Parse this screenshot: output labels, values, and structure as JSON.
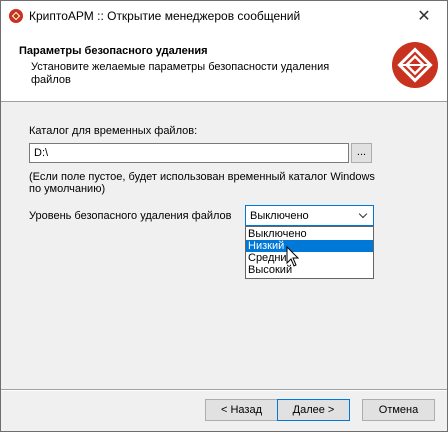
{
  "window": {
    "title": "КриптоАРМ :: Открытие менеджеров сообщений",
    "close_glyph": "✕"
  },
  "header": {
    "title": "Параметры безопасного удаления",
    "subtitle": "Установите желаемые параметры безопасности удаления файлов"
  },
  "temp_dir": {
    "label": "Каталог для временных файлов:",
    "value": "D:\\",
    "browse_label": "...",
    "note": "(Если поле пустое, будет использован временный каталог Windows по умолчанию)"
  },
  "deletion_level": {
    "label": "Уровень безопасного удаления файлов",
    "selected": "Выключено",
    "options": [
      "Выключено",
      "Низкий",
      "Средний",
      "Высокий"
    ],
    "highlighted": "Низкий"
  },
  "buttons": {
    "back": "< Назад",
    "next": "Далее >",
    "cancel": "Отмена"
  },
  "colors": {
    "accent": "#0078d7",
    "logo_red": "#c8321e"
  },
  "icons": {
    "app": "cryptoarm-logo-icon",
    "header": "cryptoarm-logo-icon",
    "dropdown": "chevron-down-icon",
    "pointer": "mouse-cursor-icon"
  }
}
